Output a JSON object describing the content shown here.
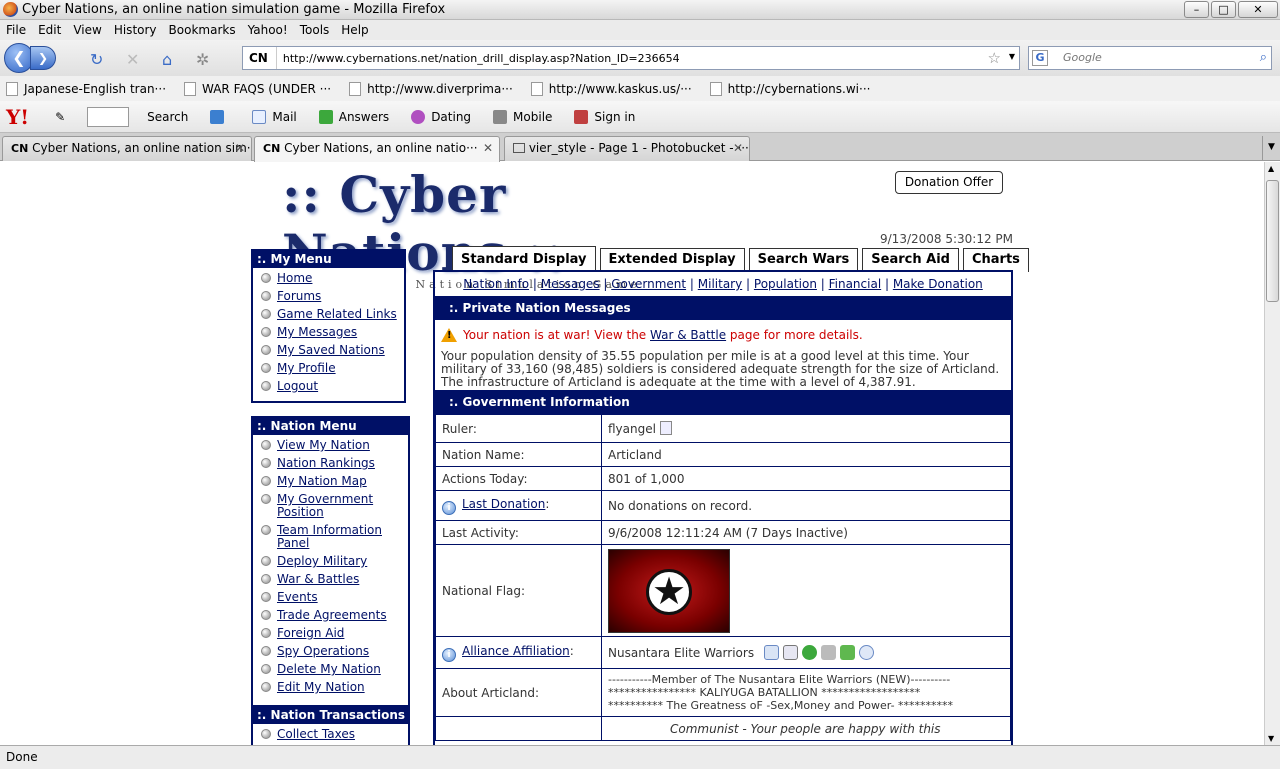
{
  "window": {
    "title": "Cyber Nations, an online nation simulation game - Mozilla Firefox"
  },
  "menubar": [
    "File",
    "Edit",
    "View",
    "History",
    "Bookmarks",
    "Yahoo!",
    "Tools",
    "Help"
  ],
  "navbar": {
    "site_id": "CN",
    "url": "http://www.cybernations.net/nation_drill_display.asp?Nation_ID=236654",
    "search_placeholder": "Google",
    "search_engine_letter": "G"
  },
  "bookmarks": [
    "Japanese-English tran···",
    "WAR FAQS (UNDER ···",
    "http://www.diverprima···",
    "http://www.kaskus.us/···",
    "http://cybernations.wi···"
  ],
  "yahoo_toolbar": {
    "logo": "Y!",
    "items": [
      "Search",
      "Mail",
      "Answers",
      "Dating",
      "Mobile",
      "Sign in"
    ]
  },
  "tabs": [
    {
      "label": "Cyber Nations, an online nation sim···"
    },
    {
      "label": "Cyber Nations, an online natio···"
    },
    {
      "label": "vier_style - Page 1 - Photobucket - ···"
    }
  ],
  "status": "Done",
  "page": {
    "logo_main": ":: Cyber Nations ::",
    "logo_sub": "A Nation Simulation Game",
    "donation_button": "Donation Offer",
    "datetime": "9/13/2008 5:30:12 PM",
    "my_menu": {
      "title": ":. My Menu",
      "items": [
        "Home",
        "Forums",
        "Game Related Links",
        "My Messages",
        "My Saved Nations",
        "My Profile",
        "Logout"
      ]
    },
    "nation_menu": {
      "title": ":. Nation Menu",
      "items": [
        "View My Nation",
        "Nation Rankings",
        "My Nation Map",
        "My Government Position",
        "Team Information Panel",
        "Deploy Military",
        "War & Battles",
        "Events",
        "Trade Agreements",
        "Foreign Aid",
        "Spy Operations",
        "Delete My Nation",
        "Edit My Nation"
      ]
    },
    "transactions_menu": {
      "title": ":. Nation Transactions",
      "items": [
        "Collect Taxes"
      ]
    },
    "display_tabs": [
      "Standard Display",
      "Extended Display",
      "Search Wars",
      "Search Aid",
      "Charts"
    ],
    "sublinks": [
      "Nation Info",
      "Messages",
      "Government",
      "Military",
      "Population",
      "Financial",
      "Make Donation"
    ],
    "private_messages": {
      "title": ":. Private Nation Messages",
      "war_prefix": "Your nation is at war! View the ",
      "war_link": "War & Battle",
      "war_suffix": " page for more details.",
      "summary": "Your population density of 35.55 population per mile is at a good level at this time. Your military of 33,160 (98,485) soldiers is considered adequate strength for the size of Articland. The infrastructure of Articland is adequate at the time with a level of 4,387.91."
    },
    "government": {
      "title": ":. Government Information",
      "ruler_label": "Ruler:",
      "ruler": "flyangel",
      "nation_name_label": "Nation Name:",
      "nation_name": "Articland",
      "actions_label": "Actions Today:",
      "actions": "801 of 1,000",
      "last_donation_label": "Last Donation",
      "last_donation": "No donations on record.",
      "last_activity_label": "Last Activity:",
      "last_activity": "9/6/2008 12:11:24 AM (7 Days Inactive)",
      "flag_label": "National Flag:",
      "alliance_label": "Alliance Affiliation",
      "alliance": "Nusantara Elite Warriors",
      "about_label": "About Articland:",
      "about_line1": "-----------Member of The Nusantara Elite Warriors (NEW)----------",
      "about_line2": "**************** KALIYUGA BATALLION ******************",
      "about_line3": "********** The Greatness oF -Sex,Money and Power- **********",
      "government_partial": "Communist - Your people are happy with this"
    }
  }
}
